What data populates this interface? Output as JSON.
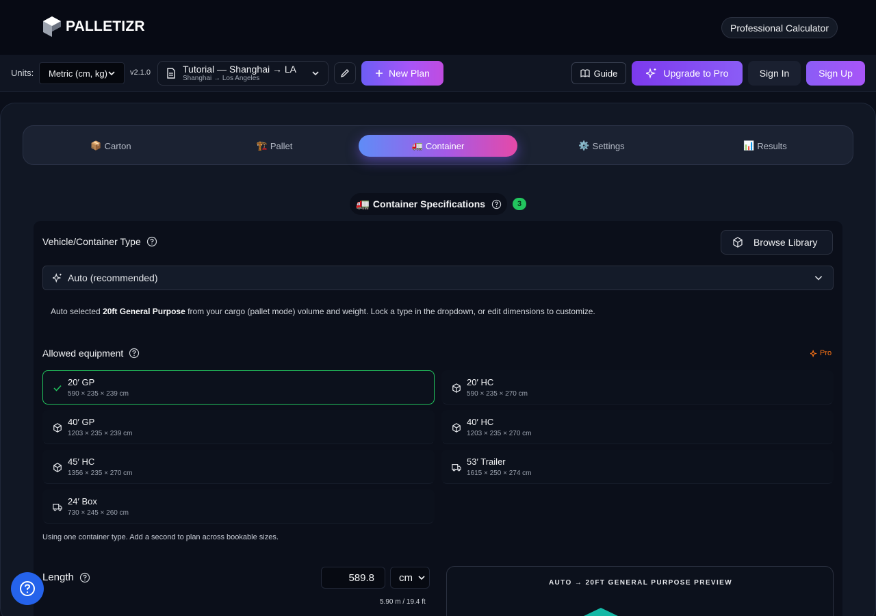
{
  "brand": {
    "name": "PALLETIZR"
  },
  "header": {
    "pro_calculator": "Professional Calculator"
  },
  "toolbar": {
    "units_label": "Units:",
    "units_value": "Metric (cm, kg)",
    "version": "v2.1.0",
    "plan_title": "Tutorial — Shanghai → LA",
    "plan_route": "Shanghai → Los Angeles",
    "new_plan": "New Plan",
    "guide": "Guide",
    "upgrade": "Upgrade to Pro",
    "sign_in": "Sign In",
    "sign_up": "Sign Up"
  },
  "tabs": [
    {
      "icon": "📦",
      "label": "Carton"
    },
    {
      "icon": "🏗️",
      "label": "Pallet"
    },
    {
      "icon": "🚛",
      "label": "Container",
      "active": true
    },
    {
      "icon": "⚙️",
      "label": "Settings"
    },
    {
      "icon": "📊",
      "label": "Results"
    }
  ],
  "section": {
    "icon": "🚛",
    "title": "Container Specifications",
    "badge": "3"
  },
  "vehicle": {
    "label": "Vehicle/Container Type",
    "browse": "Browse Library",
    "selected": "Auto (recommended)",
    "note_prefix": "Auto selected ",
    "note_bold": "20ft General Purpose",
    "note_suffix": " from your cargo (pallet mode) volume and weight. Lock a type in the dropdown, or edit dimensions to customize."
  },
  "equipment": {
    "label": "Allowed equipment",
    "pro_tag": "Pro",
    "items": [
      {
        "name": "20′ GP",
        "dims": "590 × 235 × 239 cm",
        "icon": "check-icon",
        "selected": true
      },
      {
        "name": "20′ HC",
        "dims": "590 × 235 × 270 cm",
        "icon": "box-icon"
      },
      {
        "name": "40′ GP",
        "dims": "1203 × 235 × 239 cm",
        "icon": "box-icon"
      },
      {
        "name": "40′ HC",
        "dims": "1203 × 235 × 270 cm",
        "icon": "box-icon"
      },
      {
        "name": "45′ HC",
        "dims": "1356 × 235 × 270 cm",
        "icon": "box-icon"
      },
      {
        "name": "53′ Trailer",
        "dims": "1615 × 250 × 274 cm",
        "icon": "truck-icon"
      },
      {
        "name": "24′ Box",
        "dims": "730 × 245 × 260 cm",
        "icon": "truck-icon"
      }
    ],
    "footnote": "Using one container type. Add a second to plan across bookable sizes."
  },
  "length": {
    "label": "Length",
    "value": "589.8",
    "unit": "cm",
    "conversion": "5.90 m / 19.4 ft"
  },
  "preview": {
    "title": "AUTO → 20FT GENERAL PURPOSE PREVIEW"
  },
  "colors": {
    "accent": "#8b5cf6",
    "success": "#22c55e",
    "pro": "#f97316",
    "help": "#2563eb"
  }
}
